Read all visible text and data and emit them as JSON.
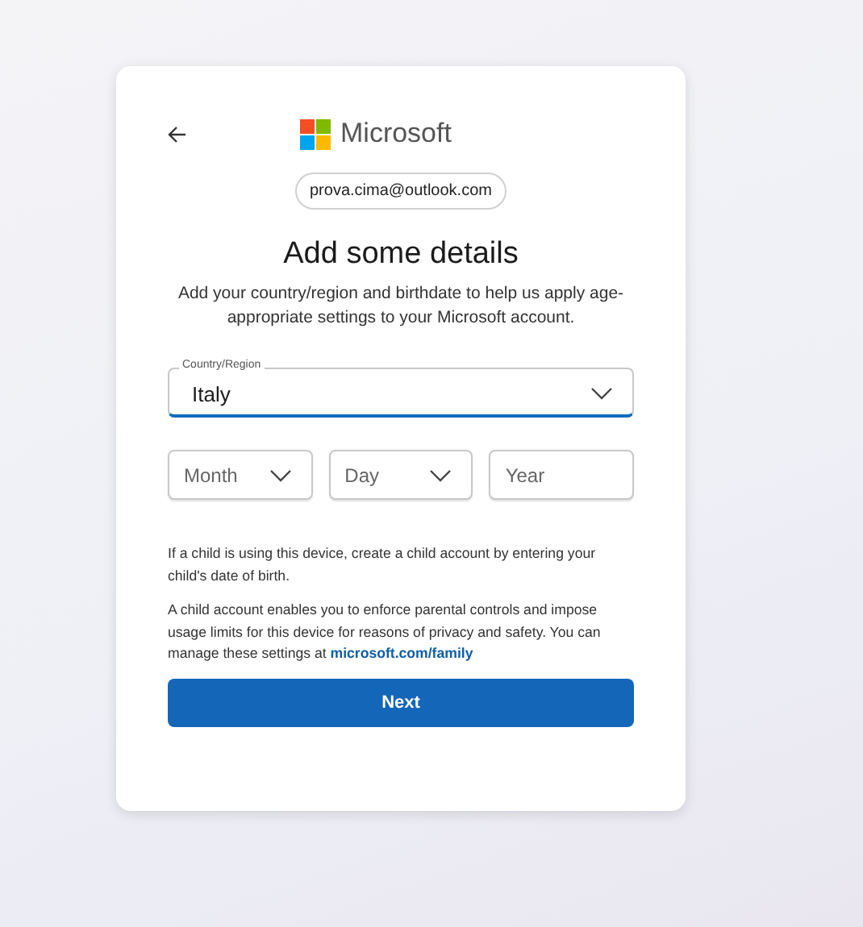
{
  "header": {
    "brand": "Microsoft"
  },
  "account": "prova.cima@outlook.com",
  "title": "Add some details",
  "description": "Add your country/region and birthdate to help us apply age-appropriate settings to your Microsoft account.",
  "country": {
    "label": "Country/Region",
    "value": "Italy",
    "focused": true
  },
  "birthdate": [
    {
      "kind": "select",
      "placeholder": "Month"
    },
    {
      "kind": "select",
      "placeholder": "Day"
    },
    {
      "kind": "input",
      "placeholder": "Year"
    }
  ],
  "notes": [
    {
      "text": "If a child is using this device, create a child account by entering your child's date of birth."
    },
    {
      "text": "A child account enables you to enforce parental controls and impose usage limits for this device for reasons of privacy and safety. You can manage these settings at",
      "link": "microsoft.com/family"
    }
  ],
  "button": "Next"
}
